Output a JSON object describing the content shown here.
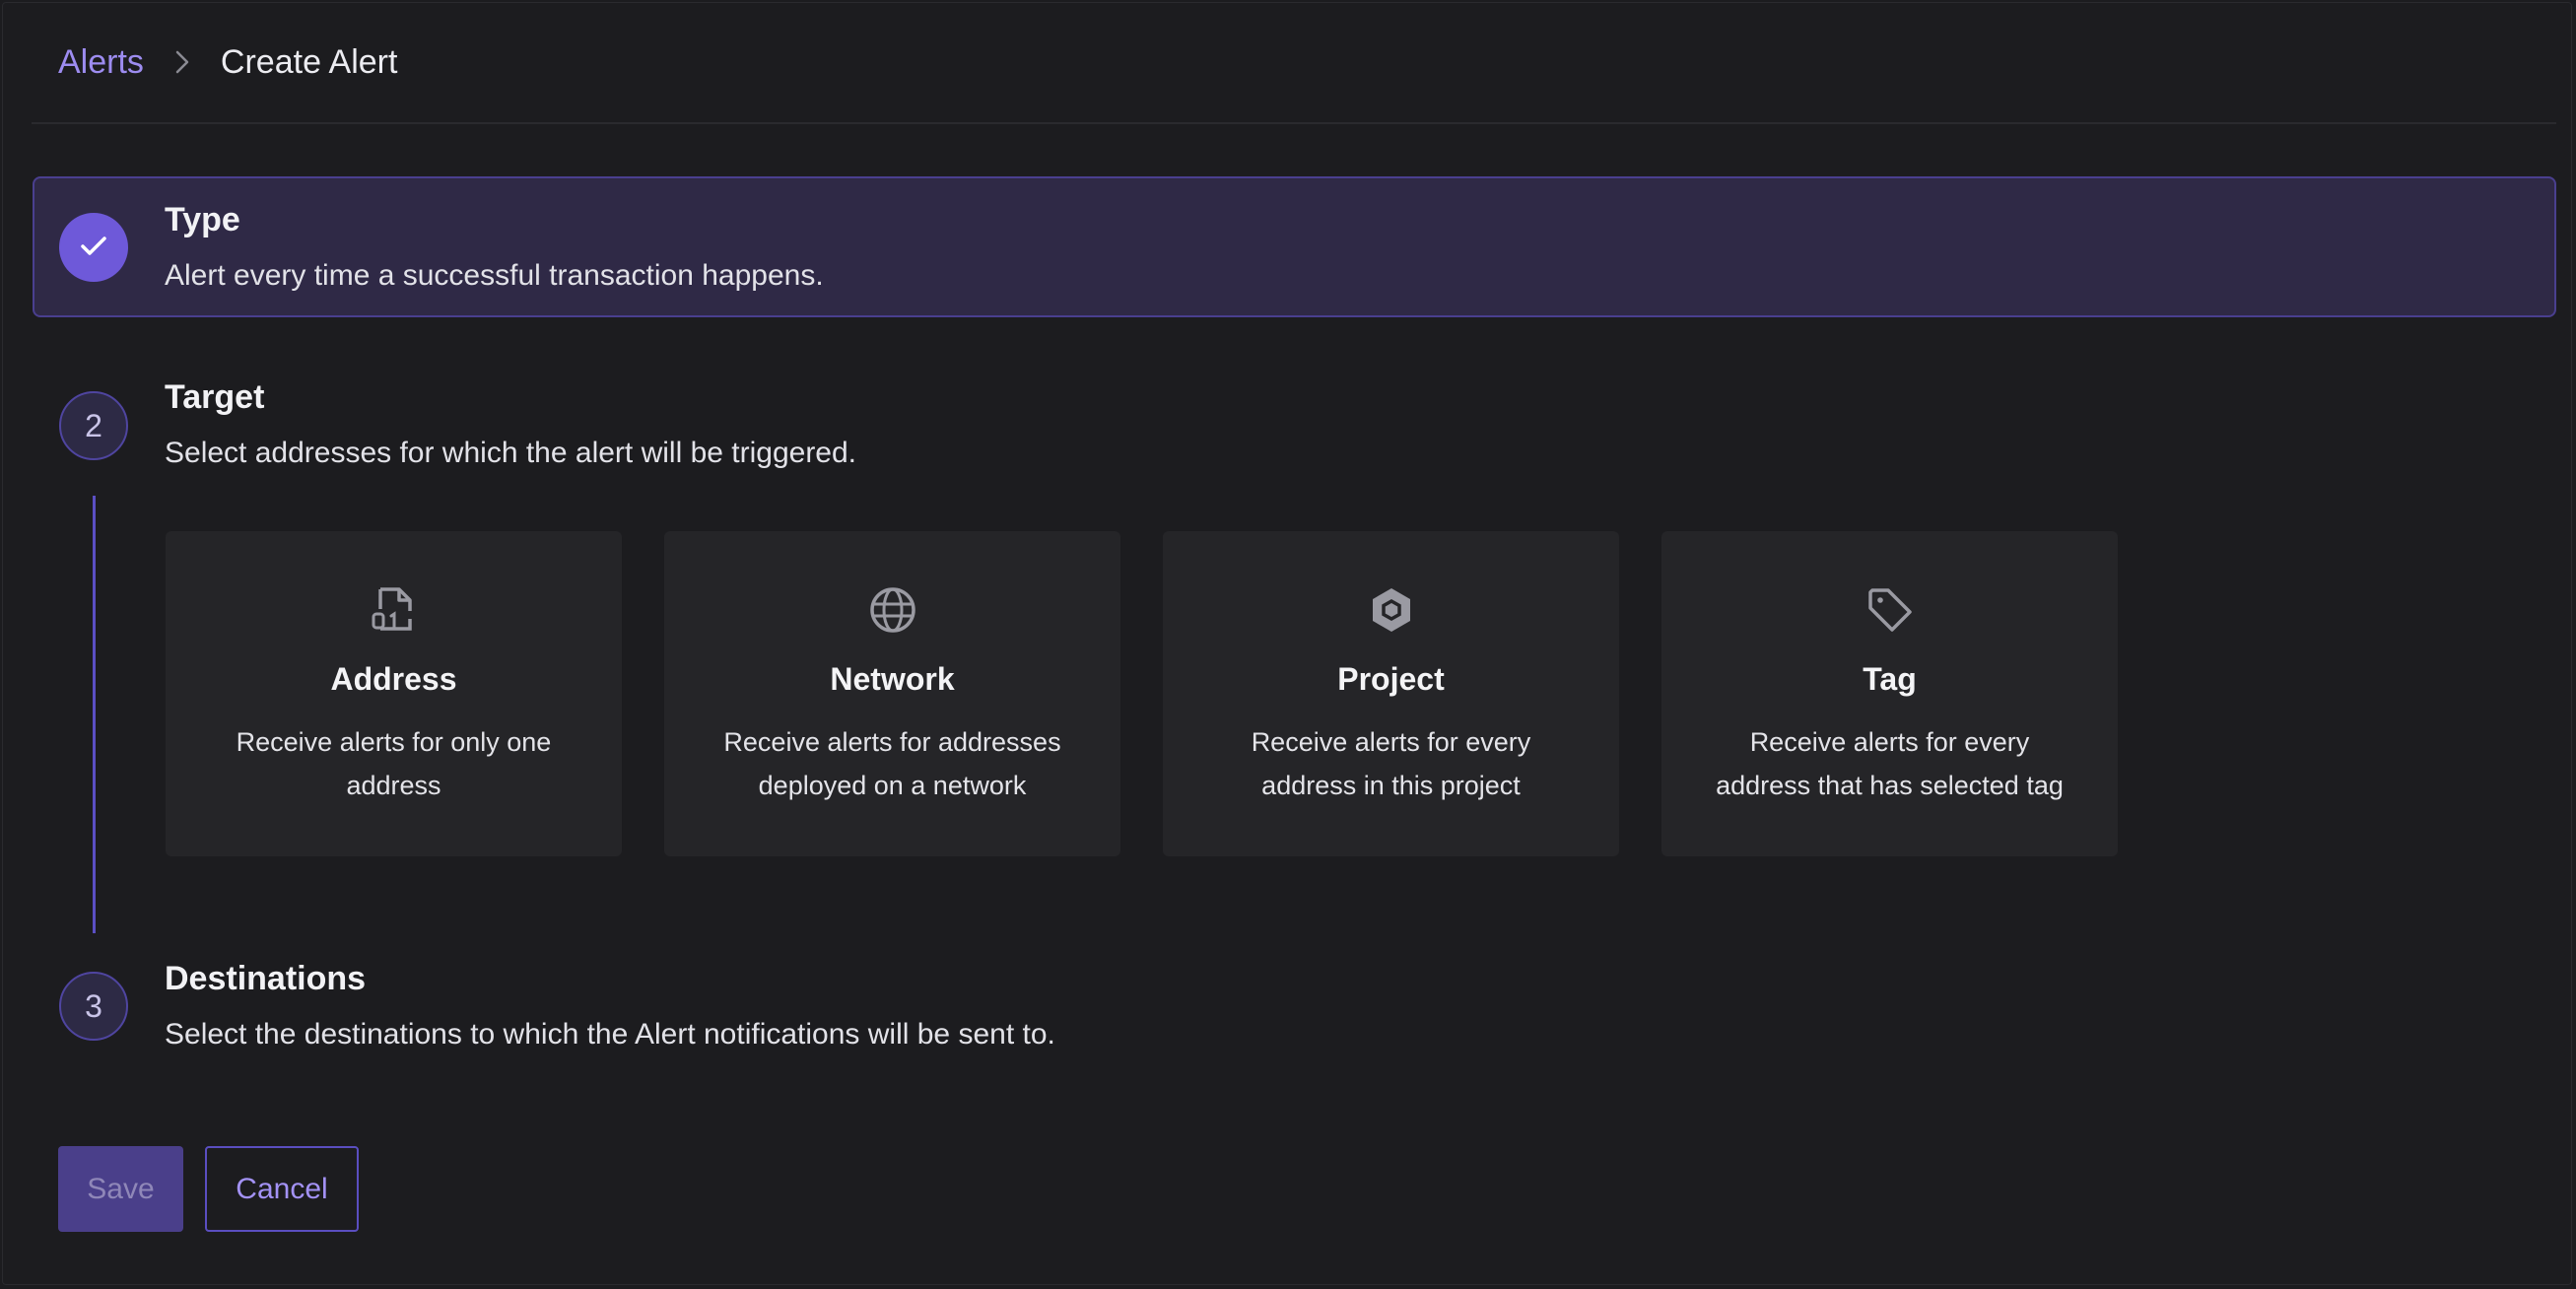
{
  "breadcrumb": {
    "parent": "Alerts",
    "current": "Create Alert"
  },
  "steps": [
    {
      "number": "",
      "status": "completed",
      "title": "Type",
      "description": "Alert every time a successful transaction happens."
    },
    {
      "number": "2",
      "status": "active",
      "title": "Target",
      "description": "Select addresses for which the alert will be triggered."
    },
    {
      "number": "3",
      "status": "pending",
      "title": "Destinations",
      "description": "Select the destinations to which the Alert notifications will be sent to."
    }
  ],
  "target_options": [
    {
      "icon": "file-binary-icon",
      "title": "Address",
      "description": "Receive alerts for only one address"
    },
    {
      "icon": "globe-icon",
      "title": "Network",
      "description": "Receive alerts for addresses deployed on a network"
    },
    {
      "icon": "hexagon-icon",
      "title": "Project",
      "description": "Receive alerts for every address in this project"
    },
    {
      "icon": "tag-icon",
      "title": "Tag",
      "description": "Receive alerts for every address that has selected tag"
    }
  ],
  "actions": {
    "save_label": "Save",
    "cancel_label": "Cancel"
  },
  "colors": {
    "background": "#1c1c1f",
    "accent": "#6e59d9",
    "link": "#9d8cf0",
    "card": "#252528"
  }
}
